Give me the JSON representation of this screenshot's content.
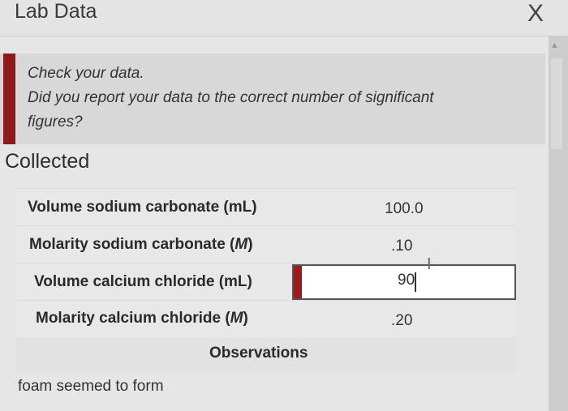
{
  "window": {
    "title": "Lab Data",
    "close_label": "X"
  },
  "alert": {
    "line1": "Check your data.",
    "line2": "Did you report your data to the correct number of significant",
    "line3": "figures?",
    "accent": "#8e1a1e"
  },
  "collected": {
    "heading": "Collected",
    "rows": [
      {
        "label": "Volume sodium carbonate (mL)",
        "value": "100.0"
      },
      {
        "label": "Molarity sodium carbonate (",
        "unit": "M",
        "close": ")",
        "value": ".10"
      },
      {
        "label": "Volume calcium chloride (mL)",
        "value": "90"
      },
      {
        "label": "Molarity calcium chloride (",
        "unit": "M",
        "close": ")",
        "value": ".20"
      }
    ]
  },
  "observations": {
    "heading": "Observations",
    "text": "foam seemed to form"
  }
}
